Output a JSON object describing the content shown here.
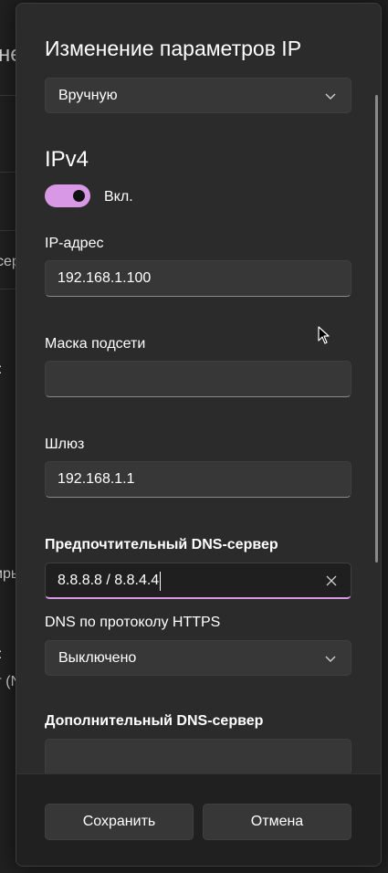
{
  "background_fragments": {
    "top": "не",
    "mid1": "сер",
    "mid2": ":",
    "mid3": "иры",
    "mid4": ":",
    "mid5": "г (N"
  },
  "dialog": {
    "title": "Изменение параметров IP",
    "mode_select": {
      "value": "Вручную"
    },
    "ipv4": {
      "heading": "IPv4",
      "toggle": {
        "state": "on",
        "label": "Вкл."
      },
      "ip_address": {
        "label": "IP-адрес",
        "value": "192.168.1.100"
      },
      "subnet_mask": {
        "label": "Маска подсети",
        "value": ""
      },
      "gateway": {
        "label": "Шлюз",
        "value": "192.168.1.1"
      },
      "preferred_dns": {
        "label": "Предпочтительный DNS-сервер",
        "value": "8.8.8.8 / 8.8.4.4"
      },
      "dns_https": {
        "label": "DNS по протоколу HTTPS",
        "value": "Выключено"
      },
      "alternate_dns": {
        "label": "Дополнительный DNS-сервер",
        "value": ""
      }
    },
    "footer": {
      "save_label": "Сохранить",
      "cancel_label": "Отмена"
    }
  },
  "colors": {
    "accent": "#d898e6",
    "dialog_bg": "#2b2b2b",
    "field_bg": "#373737"
  }
}
